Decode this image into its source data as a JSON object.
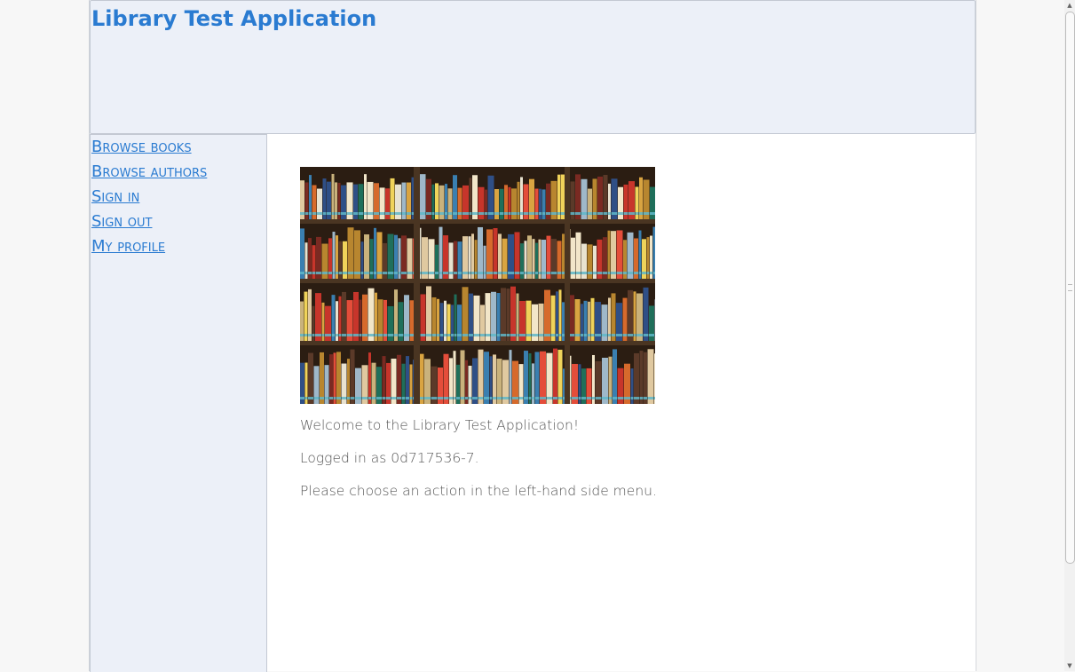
{
  "app": {
    "title": "Library Test Application"
  },
  "sidebar": {
    "items": [
      {
        "label": "Browse books"
      },
      {
        "label": "Browse authors"
      },
      {
        "label": "Sign in"
      },
      {
        "label": "Sign out"
      },
      {
        "label": "My profile"
      }
    ]
  },
  "main": {
    "welcome": "Welcome to the Library Test Application!",
    "logged_in": "Logged in as 0d717536-7.",
    "instruction": "Please choose an action in the left-hand side menu."
  },
  "colors": {
    "accent": "#2a7bd1",
    "panel_bg": "#ecf0f8",
    "text": "#555555"
  },
  "icons": {
    "scroll_up": "arrow-up-icon",
    "scroll_down": "arrow-down-icon"
  }
}
